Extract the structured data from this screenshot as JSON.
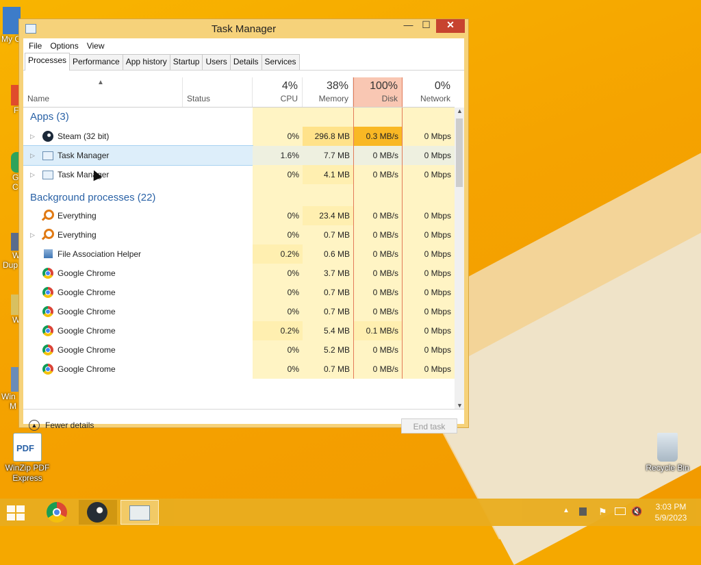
{
  "desktop": {
    "icons": [
      {
        "name": "WinZip PDF Express",
        "line1": "WinZip PDF",
        "line2": "Express"
      },
      {
        "name": "Recycle Bin",
        "line1": "Recycle Bin",
        "line2": ""
      }
    ],
    "left_labels": [
      "My C",
      "F",
      "G",
      "C",
      "W",
      "Dup",
      "W",
      "Win",
      "M"
    ]
  },
  "window": {
    "title": "Task Manager",
    "min_glyph": "—",
    "max_glyph": "☐",
    "close_glyph": "✕",
    "menu": [
      "File",
      "Options",
      "View"
    ],
    "tabs": [
      "Processes",
      "Performance",
      "App history",
      "Startup",
      "Users",
      "Details",
      "Services"
    ],
    "active_tab": "Processes"
  },
  "columns": {
    "name": "Name",
    "status": "Status",
    "cpu": {
      "pct": "4%",
      "label": "CPU"
    },
    "memory": {
      "pct": "38%",
      "label": "Memory"
    },
    "disk": {
      "pct": "100%",
      "label": "Disk"
    },
    "network": {
      "pct": "0%",
      "label": "Network"
    }
  },
  "groups": {
    "apps": "Apps (3)",
    "background": "Background processes (22)"
  },
  "rows": [
    {
      "name": "Steam (32 bit)",
      "icon": "steam-icon",
      "cpu": "0%",
      "mem": "296.8 MB",
      "disk": "0.3 MB/s",
      "net": "0 Mbps"
    },
    {
      "name": "Task Manager",
      "icon": "task-manager-icon",
      "cpu": "1.6%",
      "mem": "7.7 MB",
      "disk": "0 MB/s",
      "net": "0 Mbps"
    },
    {
      "name": "Task Manager",
      "icon": "task-manager-icon",
      "cpu": "0%",
      "mem": "4.1 MB",
      "disk": "0 MB/s",
      "net": "0 Mbps"
    },
    {
      "name": "Everything",
      "icon": "search-icon",
      "cpu": "0%",
      "mem": "23.4 MB",
      "disk": "0 MB/s",
      "net": "0 Mbps"
    },
    {
      "name": "Everything",
      "icon": "search-icon",
      "cpu": "0%",
      "mem": "0.7 MB",
      "disk": "0 MB/s",
      "net": "0 Mbps"
    },
    {
      "name": "File Association Helper",
      "icon": "file-association-icon",
      "cpu": "0.2%",
      "mem": "0.6 MB",
      "disk": "0 MB/s",
      "net": "0 Mbps"
    },
    {
      "name": "Google Chrome",
      "icon": "chrome-icon",
      "cpu": "0%",
      "mem": "3.7 MB",
      "disk": "0 MB/s",
      "net": "0 Mbps"
    },
    {
      "name": "Google Chrome",
      "icon": "chrome-icon",
      "cpu": "0%",
      "mem": "0.7 MB",
      "disk": "0 MB/s",
      "net": "0 Mbps"
    },
    {
      "name": "Google Chrome",
      "icon": "chrome-icon",
      "cpu": "0%",
      "mem": "0.7 MB",
      "disk": "0 MB/s",
      "net": "0 Mbps"
    },
    {
      "name": "Google Chrome",
      "icon": "chrome-icon",
      "cpu": "0.2%",
      "mem": "5.4 MB",
      "disk": "0.1 MB/s",
      "net": "0 Mbps"
    },
    {
      "name": "Google Chrome",
      "icon": "chrome-icon",
      "cpu": "0%",
      "mem": "5.2 MB",
      "disk": "0 MB/s",
      "net": "0 Mbps"
    },
    {
      "name": "Google Chrome",
      "icon": "chrome-icon",
      "cpu": "0%",
      "mem": "0.7 MB",
      "disk": "0 MB/s",
      "net": "0 Mbps"
    }
  ],
  "footer": {
    "fewer_details": "Fewer details",
    "end_task": "End task"
  },
  "taskbar": {
    "clock_time": "3:03 PM",
    "clock_date": "5/9/2023",
    "apps": [
      "chrome-icon",
      "steam-icon",
      "task-manager-icon"
    ]
  },
  "colors": {
    "accent_disk_header": "#f9c7b3",
    "group_heading": "#2a62a6",
    "desktop": "#f5a800"
  }
}
